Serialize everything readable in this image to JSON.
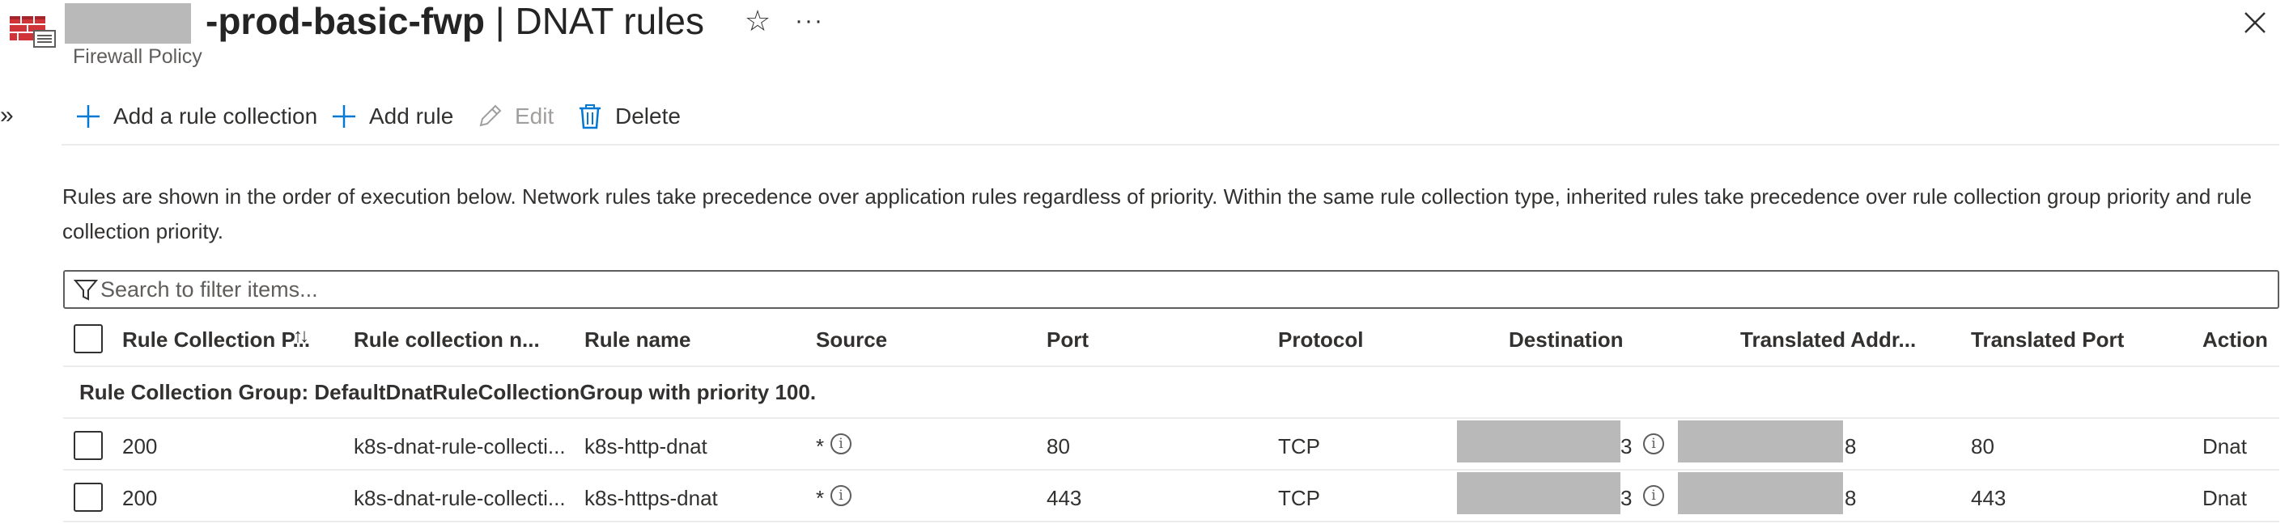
{
  "header": {
    "title_bold": "-prod-basic-fwp",
    "title_rest": " | DNAT rules",
    "subtitle": "Firewall Policy",
    "icons": {
      "resource": "firewall-policy-icon",
      "favorite": "star-icon",
      "more": "more-icon",
      "close": "close-icon",
      "collapse": "chevron-double-right-icon"
    }
  },
  "toolbar": {
    "add_collection": "Add a rule collection",
    "add_rule": "Add rule",
    "edit": "Edit",
    "delete": "Delete"
  },
  "info_text": "Rules are shown in the order of execution below. Network rules take precedence over application rules regardless of priority. Within the same rule collection type, inherited rules take precedence over rule collection group priority and rule collection priority.",
  "search": {
    "placeholder": "Search to filter items..."
  },
  "table": {
    "columns": [
      "Rule Collection P...",
      "Rule collection n...",
      "Rule name",
      "Source",
      "Port",
      "Protocol",
      "Destination",
      "Translated Addr...",
      "Translated Port",
      "Action"
    ],
    "group_label": "Rule Collection Group: DefaultDnatRuleCollectionGroup with priority 100.",
    "rows": [
      {
        "priority": "200",
        "collection": "k8s-dnat-rule-collecti...",
        "name": "k8s-http-dnat",
        "source": "*",
        "port": "80",
        "protocol": "TCP",
        "destination_suffix": "3",
        "translated_suffix": "8",
        "translated_port": "80",
        "action": "Dnat"
      },
      {
        "priority": "200",
        "collection": "k8s-dnat-rule-collecti...",
        "name": "k8s-https-dnat",
        "source": "*",
        "port": "443",
        "protocol": "TCP",
        "destination_suffix": "3",
        "translated_suffix": "8",
        "translated_port": "443",
        "action": "Dnat"
      }
    ]
  },
  "colors": {
    "accent": "#0078d4",
    "text": "#323130",
    "redaction": "#b9b9b9",
    "firewall_red": "#d13438"
  }
}
